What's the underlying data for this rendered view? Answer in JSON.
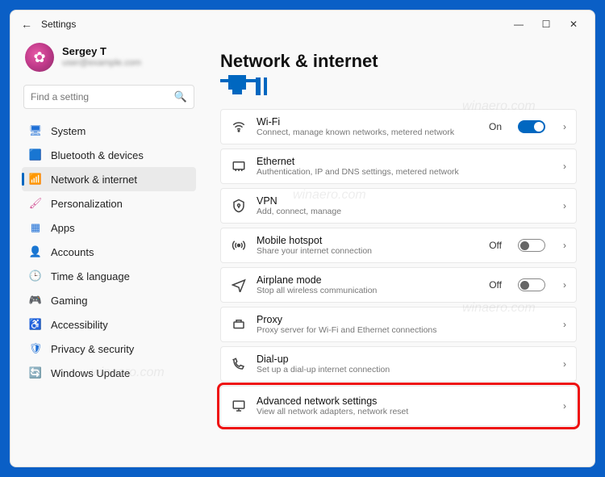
{
  "titlebar": {
    "app_title": "Settings"
  },
  "profile": {
    "name": "Sergey T",
    "email": "user@example.com"
  },
  "search": {
    "placeholder": "Find a setting"
  },
  "sidebar": {
    "items": [
      {
        "label": "System",
        "icon": "🖥"
      },
      {
        "label": "Bluetooth & devices",
        "icon": "🟦"
      },
      {
        "label": "Network & internet",
        "icon": "📶"
      },
      {
        "label": "Personalization",
        "icon": "🖌"
      },
      {
        "label": "Apps",
        "icon": "▦"
      },
      {
        "label": "Accounts",
        "icon": "👤"
      },
      {
        "label": "Time & language",
        "icon": "🕒"
      },
      {
        "label": "Gaming",
        "icon": "🎮"
      },
      {
        "label": "Accessibility",
        "icon": "♿"
      },
      {
        "label": "Privacy & security",
        "icon": "🛡"
      },
      {
        "label": "Windows Update",
        "icon": "🔄"
      }
    ],
    "active_index": 2
  },
  "page": {
    "title": "Network & internet"
  },
  "rows": [
    {
      "key": "wifi",
      "title": "Wi-Fi",
      "sub": "Connect, manage known networks, metered network",
      "state": "On",
      "toggle": "on",
      "chevron": true
    },
    {
      "key": "ethernet",
      "title": "Ethernet",
      "sub": "Authentication, IP and DNS settings, metered network",
      "chevron": true
    },
    {
      "key": "vpn",
      "title": "VPN",
      "sub": "Add, connect, manage",
      "chevron": true
    },
    {
      "key": "hotspot",
      "title": "Mobile hotspot",
      "sub": "Share your internet connection",
      "state": "Off",
      "toggle": "off",
      "chevron": true
    },
    {
      "key": "airplane",
      "title": "Airplane mode",
      "sub": "Stop all wireless communication",
      "state": "Off",
      "toggle": "off",
      "chevron": true
    },
    {
      "key": "proxy",
      "title": "Proxy",
      "sub": "Proxy server for Wi-Fi and Ethernet connections",
      "chevron": true
    },
    {
      "key": "dialup",
      "title": "Dial-up",
      "sub": "Set up a dial-up internet connection",
      "chevron": true
    },
    {
      "key": "advanced",
      "title": "Advanced network settings",
      "sub": "View all network adapters, network reset",
      "chevron": true,
      "highlight": true
    }
  ],
  "watermark": "winaero.com"
}
